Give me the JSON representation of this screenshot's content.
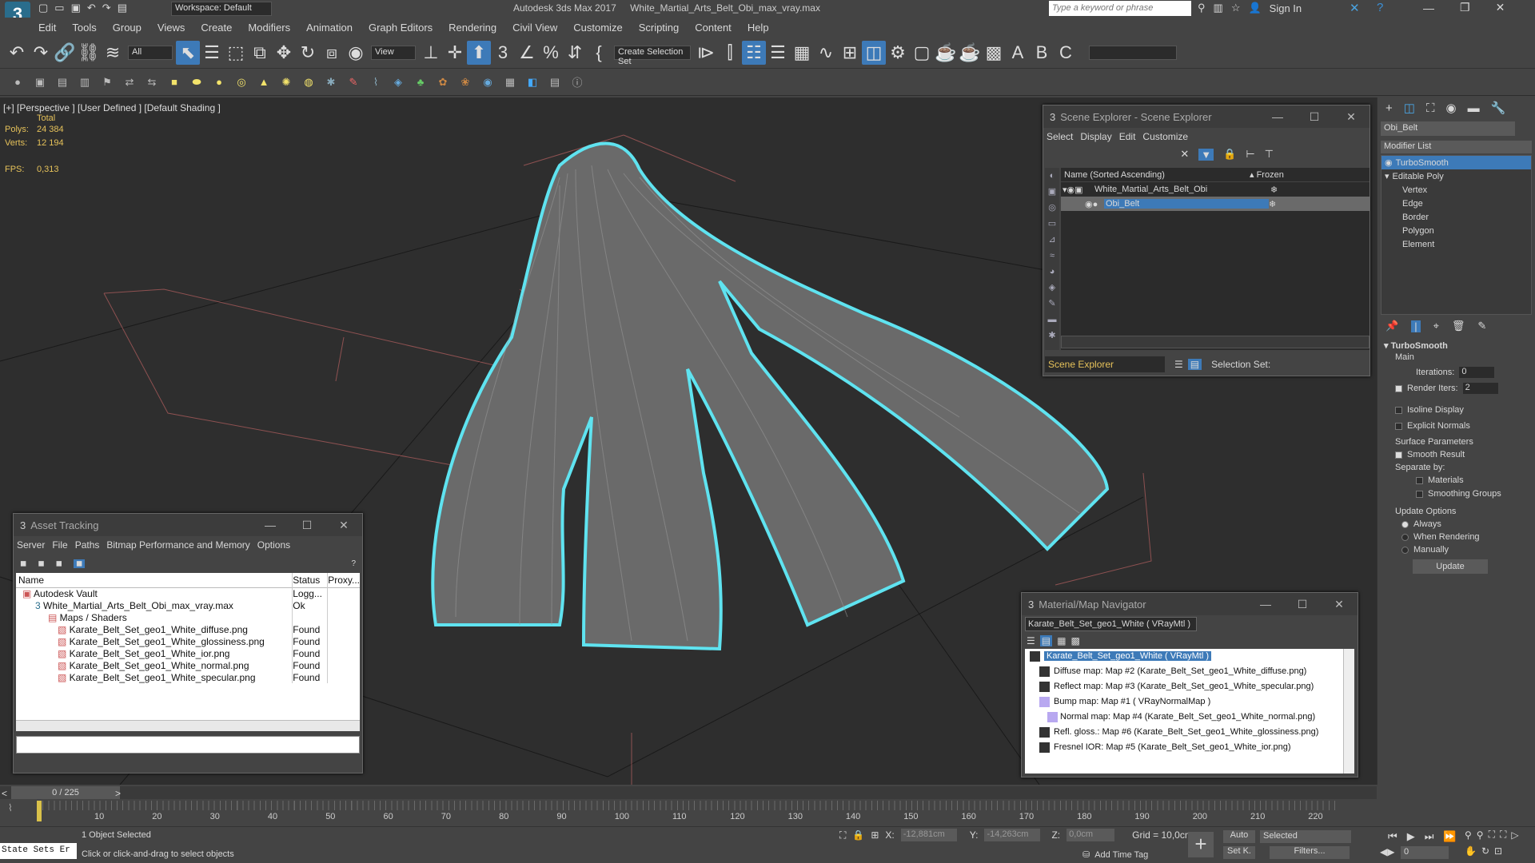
{
  "app": {
    "logo_text": "3",
    "logo_sub": "MAX",
    "workspace_label": "Workspace: Default",
    "window_title": "Autodesk 3ds Max 2017",
    "file_title": "White_Martial_Arts_Belt_Obi_max_vray.max",
    "search_placeholder": "Type a keyword or phrase",
    "sign_in": "Sign In"
  },
  "menu": [
    "Edit",
    "Tools",
    "Group",
    "Views",
    "Create",
    "Modifiers",
    "Animation",
    "Graph Editors",
    "Rendering",
    "Civil View",
    "Customize",
    "Scripting",
    "Content",
    "Help"
  ],
  "toolbar": {
    "selection_filter": "All",
    "ref_coord": "View",
    "create_selection_set": "Create Selection Set"
  },
  "viewport": {
    "label": "[+] [Perspective ] [User Defined ] [Default Shading ]",
    "total": "Total",
    "polys_label": "Polys:",
    "polys_value": "24 384",
    "verts_label": "Verts:",
    "verts_value": "12 194",
    "fps_label": "FPS:",
    "fps_value": "0,313",
    "wire_color": "#5fe3f0"
  },
  "scene_explorer": {
    "title": "Scene Explorer - Scene Explorer",
    "menu": [
      "Select",
      "Display",
      "Edit",
      "Customize"
    ],
    "col_name": "Name (Sorted Ascending)",
    "col_frozen": "▴ Frozen",
    "rows": [
      "White_Martial_Arts_Belt_Obi",
      "Obi_Belt"
    ],
    "footer_name": "Scene Explorer",
    "selection_set": "Selection Set:"
  },
  "asset_tracking": {
    "title": "Asset Tracking",
    "menu": [
      "Server",
      "File",
      "Paths",
      "Bitmap Performance and Memory",
      "Options"
    ],
    "columns": [
      "Name",
      "Status",
      "Proxy..."
    ],
    "rows": [
      {
        "name": "Autodesk Vault",
        "status": "Logg..."
      },
      {
        "name": "White_Martial_Arts_Belt_Obi_max_vray.max",
        "status": "Ok"
      },
      {
        "name": "Maps / Shaders",
        "status": ""
      },
      {
        "name": "Karate_Belt_Set_geo1_White_diffuse.png",
        "status": "Found"
      },
      {
        "name": "Karate_Belt_Set_geo1_White_glossiness.png",
        "status": "Found"
      },
      {
        "name": "Karate_Belt_Set_geo1_White_ior.png",
        "status": "Found"
      },
      {
        "name": "Karate_Belt_Set_geo1_White_normal.png",
        "status": "Found"
      },
      {
        "name": "Karate_Belt_Set_geo1_White_specular.png",
        "status": "Found"
      }
    ]
  },
  "material_nav": {
    "title": "Material/Map Navigator",
    "field": "Karate_Belt_Set_geo1_White  ( VRayMtl )",
    "items": [
      "Karate_Belt_Set_geo1_White  ( VRayMtl )",
      "Diffuse map: Map #2 (Karate_Belt_Set_geo1_White_diffuse.png)",
      "Reflect map: Map #3 (Karate_Belt_Set_geo1_White_specular.png)",
      "Bump map: Map #1  ( VRayNormalMap )",
      "Normal map: Map #4 (Karate_Belt_Set_geo1_White_normal.png)",
      "Refl. gloss.: Map #6 (Karate_Belt_Set_geo1_White_glossiness.png)",
      "Fresnel IOR: Map #5 (Karate_Belt_Set_geo1_White_ior.png)"
    ]
  },
  "command_panel": {
    "object_name": "Obi_Belt",
    "modifier_list": "Modifier List",
    "stack": [
      "TurboSmooth",
      "Editable Poly",
      "Vertex",
      "Edge",
      "Border",
      "Polygon",
      "Element"
    ],
    "rollout_title": "TurboSmooth",
    "main": "Main",
    "iterations_label": "Iterations:",
    "iterations_value": "0",
    "render_iters_label": "Render Iters:",
    "render_iters_value": "2",
    "isoline": "Isoline Display",
    "explicit_normals": "Explicit Normals",
    "surface_params": "Surface Parameters",
    "smooth_result": "Smooth Result",
    "separate_by": "Separate by:",
    "materials": "Materials",
    "smoothing_groups": "Smoothing Groups",
    "update_options": "Update Options",
    "always": "Always",
    "when_rendering": "When Rendering",
    "manually": "Manually",
    "update_button": "Update"
  },
  "timeline": {
    "frame": "0 / 225",
    "ticks": [
      "10",
      "20",
      "30",
      "40",
      "50",
      "60",
      "70",
      "80",
      "90",
      "100",
      "110",
      "120",
      "130",
      "140",
      "150",
      "160",
      "170",
      "180",
      "190",
      "200",
      "210",
      "220"
    ]
  },
  "status": {
    "state_sets": "State Sets Er",
    "selected": "1 Object Selected",
    "prompt": "Click or click-and-drag to select objects",
    "x_label": "X:",
    "x_value": "-12,881cm",
    "y_label": "Y:",
    "y_value": "-14,263cm",
    "z_label": "Z:",
    "z_value": "0,0cm",
    "grid": "Grid = 10,0cm",
    "add_time_tag": "Add Time Tag",
    "auto": "Auto",
    "selected_dd": "Selected",
    "set_k": "Set K.",
    "filters": "Filters...",
    "frame_field": "0"
  }
}
